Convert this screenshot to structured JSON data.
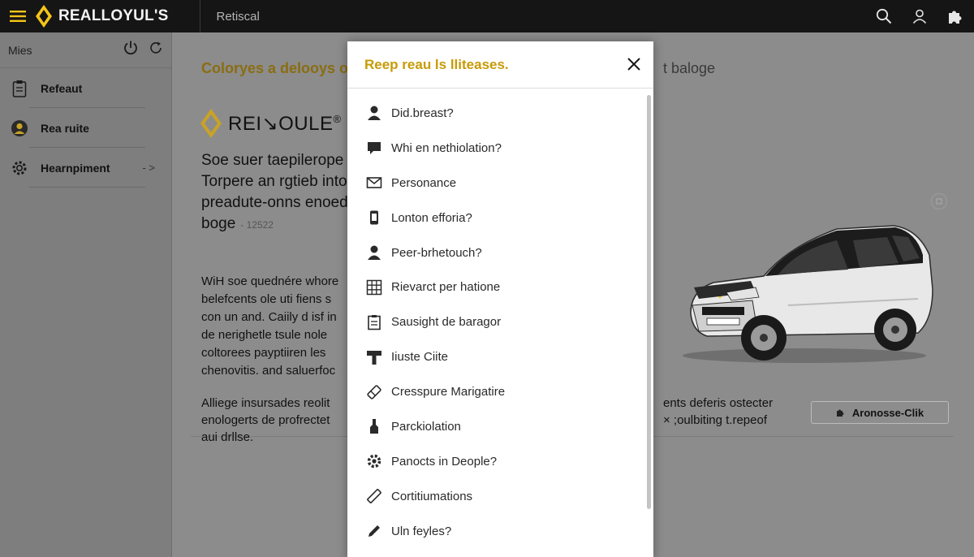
{
  "topbar": {
    "brand": "REALLOYUL'S",
    "title": "Retiscal"
  },
  "sidebar": {
    "header_label": "Mies",
    "items": [
      {
        "label": "Refeaut",
        "icon": "clipboard-icon"
      },
      {
        "label": "Rea ruite",
        "icon": "user-circle-icon"
      },
      {
        "label": "Hearnpiment",
        "icon": "gear-icon",
        "chevron": "- >"
      }
    ]
  },
  "main": {
    "headline": "Coloryes a delooys o",
    "headline_right": "t baloge",
    "logo_text": "REI↘OULE",
    "logo_reg": "®",
    "heading_lines": [
      "Soe suer taepilerope",
      "Torpere an rgtieb into",
      "preadute-onns enoed",
      "boge"
    ],
    "heading_num": "- 12522",
    "body_lines": [
      "WiH soe quednére whore",
      "belefcents ole uti fiens s",
      "con un and. Caiily d isf in",
      "de nerighetle tsule nole",
      "coltorees payptiiren les",
      "chenovitis. and saluerfoc"
    ],
    "body_lines2": [
      "Alliege insursades reolit",
      "enologerts de profrectet",
      "aui drllse."
    ],
    "right_lines": [
      "ents deferis ostecter",
      "× ;oulbiting t.repeof"
    ],
    "action_button": "Aronosse-Clik"
  },
  "modal": {
    "title": "Reep reau ls lliteases.",
    "items": [
      {
        "label": "Did.breast?",
        "icon": "person-icon"
      },
      {
        "label": "Whi en nethiolation?",
        "icon": "chat-icon"
      },
      {
        "label": "Personance",
        "icon": "envelope-icon"
      },
      {
        "label": "Lonton efforia?",
        "icon": "phone-icon"
      },
      {
        "label": "Peer-brhetouch?",
        "icon": "person-icon"
      },
      {
        "label": "Rievarct per hatione",
        "icon": "grid-icon"
      },
      {
        "label": "Sausight de baragor",
        "icon": "document-icon"
      },
      {
        "label": "Iiuste Ciite",
        "icon": "tool-icon"
      },
      {
        "label": "Cresspure Marigatire",
        "icon": "eraser-icon"
      },
      {
        "label": "Parckiolation",
        "icon": "bottle-icon"
      },
      {
        "label": "Panocts in Deople?",
        "icon": "gear-icon"
      },
      {
        "label": "Cortitiumations",
        "icon": "pencil-icon"
      },
      {
        "label": "Uln feyles?",
        "icon": "pen-icon"
      }
    ]
  },
  "colors": {
    "topbar": "#151515",
    "accent": "#f5c518",
    "modal_title": "#c79b06"
  }
}
